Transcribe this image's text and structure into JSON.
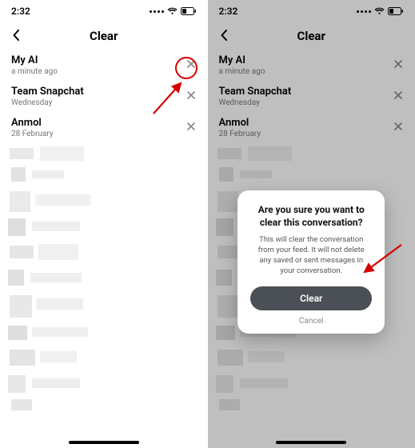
{
  "leftPhone": {
    "status": {
      "time": "2:32"
    },
    "nav": {
      "title": "Clear"
    },
    "rows": [
      {
        "name": "My AI",
        "sub": "a minute ago"
      },
      {
        "name": "Team Snapchat",
        "sub": "Wednesday"
      },
      {
        "name": "Anmol",
        "sub": "28 February"
      }
    ]
  },
  "rightPhone": {
    "status": {
      "time": "2:32"
    },
    "nav": {
      "title": "Clear"
    },
    "rows": [
      {
        "name": "My AI",
        "sub": "a minute ago"
      },
      {
        "name": "Team Snapchat",
        "sub": "Wednesday"
      },
      {
        "name": "Anmol",
        "sub": "28 February"
      }
    ],
    "dialog": {
      "title": "Are you sure you want to clear this conversation?",
      "body": "This will clear the conversation from your feed. It will not delete any saved or sent messages in your conversation.",
      "confirm": "Clear",
      "cancel": "Cancel"
    }
  }
}
